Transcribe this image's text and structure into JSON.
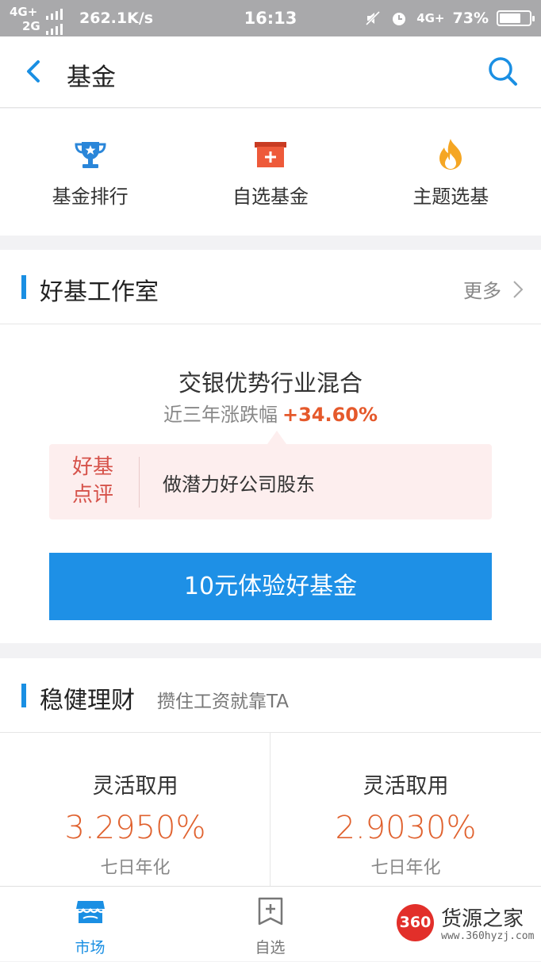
{
  "status_bar": {
    "network_top": "4G+",
    "network_bottom": "2G",
    "speed": "262.1K/s",
    "time": "16:13",
    "network_right": "4G+",
    "battery": "73%",
    "battery_level": 0.73
  },
  "header": {
    "title": "基金"
  },
  "quick_entries": [
    {
      "label": "基金排行",
      "icon": "trophy-icon"
    },
    {
      "label": "自选基金",
      "icon": "add-folder-icon"
    },
    {
      "label": "主题选基",
      "icon": "flame-icon"
    }
  ],
  "studio": {
    "title": "好基工作室",
    "more": "更多",
    "fund_name": "交银优势行业混合",
    "perf_label": "近三年涨跌幅",
    "perf_value": "+34.60%",
    "review_tag_1": "好基",
    "review_tag_2": "点评",
    "review_text": "做潜力好公司股东",
    "cta": "10元体验好基金"
  },
  "wealth": {
    "title": "稳健理财",
    "subtitle": "攒住工资就靠TA",
    "items": [
      {
        "label": "灵活取用",
        "rate": "3.2950%",
        "note": "七日年化"
      },
      {
        "label": "灵活取用",
        "rate": "2.9030%",
        "note": "七日年化"
      }
    ]
  },
  "tabbar": {
    "tabs": [
      {
        "label": "市场",
        "icon": "market-icon",
        "active": true
      },
      {
        "label": "自选",
        "icon": "bookmark-add-icon",
        "active": false
      }
    ]
  },
  "watermark": {
    "logo": "360",
    "title": "货源之家",
    "url": "www.360hyzj.com"
  },
  "colors": {
    "accent": "#1a8fe3",
    "cta": "#1e90e6",
    "rise": "#e5592b",
    "review_bg": "#fdeeee"
  }
}
